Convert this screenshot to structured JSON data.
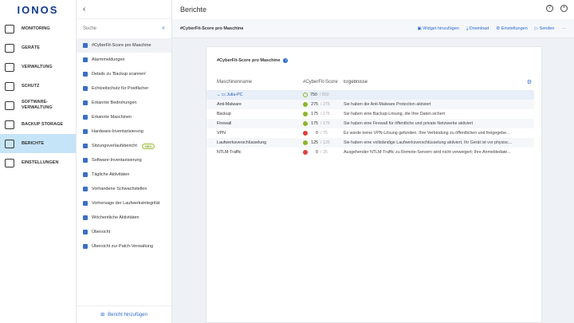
{
  "brand": "IONOS",
  "nav": [
    {
      "label": "MONITORING",
      "icon": "gauge-icon"
    },
    {
      "label": "GERÄTE",
      "icon": "monitor-icon"
    },
    {
      "label": "VERWALTUNG",
      "icon": "layers-icon"
    },
    {
      "label": "SCHUTZ",
      "icon": "shield-icon"
    },
    {
      "label": "SOFTWARE-VERWALTUNG",
      "icon": "software-icon"
    },
    {
      "label": "BACKUP STORAGE",
      "icon": "drive-icon"
    },
    {
      "label": "BERICHTE",
      "icon": "report-icon",
      "active": true
    },
    {
      "label": "EINSTELLUNGEN",
      "icon": "gear-icon"
    }
  ],
  "panel": {
    "back": "‹",
    "search_placeholder": "Suche",
    "add_report": "Bericht hinzufügen",
    "reports": [
      "#CyberFit-Score pro Maschine",
      "Alarmmeldungen",
      "Details zu 'Backup scannen'",
      "Echtzeitschutz für Postfächer",
      "Erkannte Bedrohungen",
      "Erkannte Maschinen",
      "Hardware-Inventarisierung",
      "Sitzungsverlaufsbericht",
      "Software-Inventarisierung",
      "Tägliche Aktivitäten",
      "Vorhandene Schwachstellen",
      "Vorhersage der Laufwerksintegrität",
      "Wöchentliche Aktivitäten",
      "Übersicht",
      "Übersicht zur Patch-Verwaltung"
    ],
    "new_badge": "NEU"
  },
  "header": {
    "title": "Berichte"
  },
  "toolbar": {
    "title": "#CyberFit-Score pro Maschine",
    "actions": [
      "Widget hinzufügen",
      "Download",
      "Einstellungen",
      "Senden"
    ],
    "more": "···"
  },
  "card": {
    "title": "#CyberFit-Score pro Maschine",
    "columns": [
      "Maschinenname",
      "#CyberFit-Score",
      "Ergebnisse"
    ],
    "machine": {
      "name": "Julia-PC",
      "score": "750",
      "max": "850"
    },
    "rows": [
      {
        "name": "Anti-Malware",
        "score": "275",
        "max": "275",
        "status": "ok",
        "result": "Sie haben die Anti-Malware Protection aktiviert"
      },
      {
        "name": "Backup",
        "score": "175",
        "max": "175",
        "status": "ok",
        "result": "Sie haben eine Backup-Lösung, die Ihre Daten sichert"
      },
      {
        "name": "Firewall",
        "score": "175",
        "max": "175",
        "status": "ok",
        "result": "Sie haben eine Firewall für öffentliche und private Netzwerke aktiviert"
      },
      {
        "name": "VPN",
        "score": "0",
        "max": "75",
        "status": "bad",
        "result": "Es wurde keine VPN-Lösung gefunden. Ihre Verbindung zu öffentlichen und freigegebe..."
      },
      {
        "name": "Laufwerksverschlüsselung",
        "score": "125",
        "max": "125",
        "status": "ok",
        "result": "Sie haben eine vollständige Laufwerksverschlüsselung aktiviert, Ihr Gerät ist vor physisc..."
      },
      {
        "name": "NTLM-Traffic",
        "score": "0",
        "max": "25",
        "status": "bad",
        "result": "Ausgehender NTLM-Traffic zu Remote-Servern wird nicht verweigert; Ihre Anmeldedate..."
      }
    ]
  }
}
